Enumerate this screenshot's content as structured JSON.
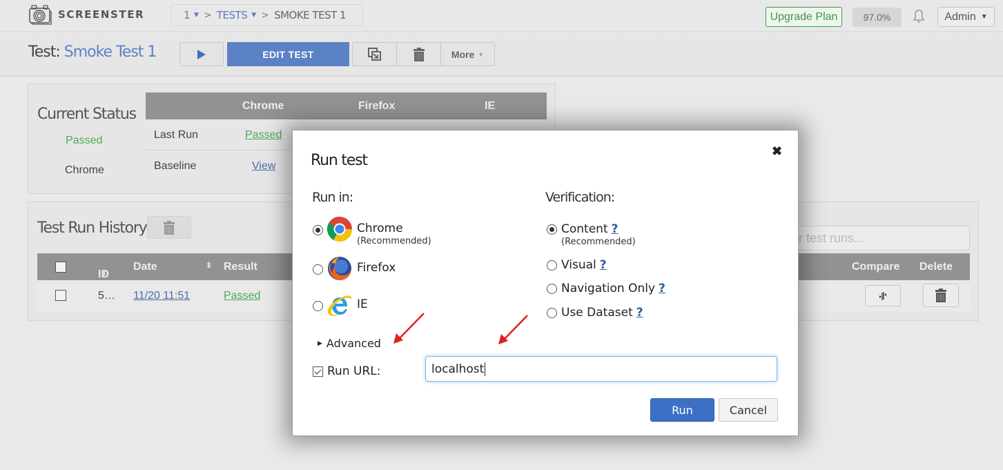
{
  "app": {
    "logo_text": "SCREENSTER",
    "breadcrumb": {
      "project": "1",
      "section": "TESTS",
      "current": "SMOKE TEST 1",
      "separator": ">"
    },
    "upgrade_label": "Upgrade Plan",
    "quota_percent": "97.0%",
    "user_menu_label": "Admin"
  },
  "test_header": {
    "prefix": "Test:",
    "name": "Smoke Test 1",
    "edit_label": "EDIT TEST",
    "more_label": "More"
  },
  "current_status": {
    "title": "Current Status",
    "summary_status": "Passed",
    "summary_browser": "Chrome",
    "columns": [
      "Chrome",
      "Firefox",
      "IE"
    ],
    "rows": [
      {
        "label": "Last Run",
        "chrome": "Passed"
      },
      {
        "label": "Baseline",
        "chrome": "View"
      }
    ]
  },
  "history": {
    "title": "Test Run History",
    "filter_placeholder": "Filter test runs...",
    "filter_visible_text": "ter test runs...",
    "columns": {
      "id": "ID",
      "date": "Date",
      "result": "Result",
      "compare": "Compare",
      "delete": "Delete"
    },
    "rows": [
      {
        "id": "5…",
        "date": "11/20 11:51",
        "result": "Passed"
      }
    ]
  },
  "dialog": {
    "title": "Run test",
    "run_in_label": "Run in:",
    "verification_label": "Verification:",
    "browsers": [
      {
        "label": "Chrome",
        "sub": "(Recommended)",
        "checked": true,
        "icon": "chrome-icon"
      },
      {
        "label": "Firefox",
        "sub": "",
        "checked": false,
        "icon": "firefox-icon"
      },
      {
        "label": "IE",
        "sub": "",
        "checked": false,
        "icon": "ie-icon"
      }
    ],
    "verifications": [
      {
        "label": "Content",
        "sub": "(Recommended)",
        "checked": true,
        "help": "?"
      },
      {
        "label": "Visual",
        "sub": "",
        "checked": false,
        "help": "?"
      },
      {
        "label": "Navigation Only",
        "sub": "",
        "checked": false,
        "help": "?"
      },
      {
        "label": "Use Dataset",
        "sub": "",
        "checked": false,
        "help": "?"
      }
    ],
    "advanced_label": "Advanced",
    "run_url_label": "Run URL:",
    "run_url_checked": true,
    "run_url_value": "localhost",
    "run_label": "Run",
    "cancel_label": "Cancel",
    "close_glyph": "✖"
  },
  "colors": {
    "accent_blue": "#5b82c4",
    "passed_green": "#4caa57",
    "run_button": "#3c70c6",
    "annotation_arrow": "#e02020"
  }
}
